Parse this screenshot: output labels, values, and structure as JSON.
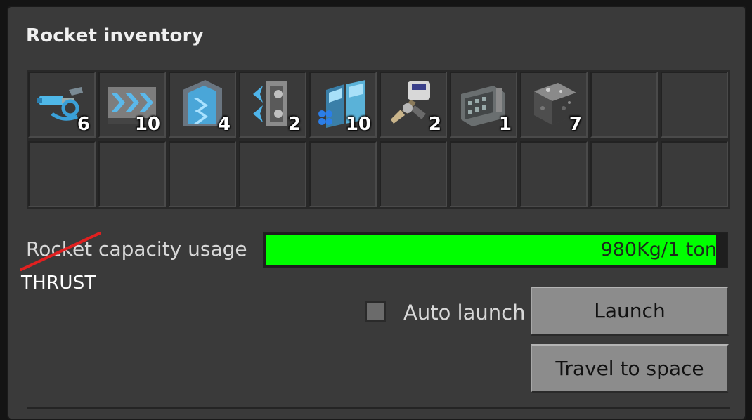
{
  "panel": {
    "title": "Rocket inventory"
  },
  "inventory": {
    "slots": [
      {
        "icon": "electric-pole-icon",
        "count": "6"
      },
      {
        "icon": "express-transport-belt-icon",
        "count": "10"
      },
      {
        "icon": "express-underground-belt-icon",
        "count": "4"
      },
      {
        "icon": "express-splitter-icon",
        "count": "2"
      },
      {
        "icon": "solar-panel-icon",
        "count": "10"
      },
      {
        "icon": "inserter-icon",
        "count": "2"
      },
      {
        "icon": "assembling-machine-icon",
        "count": "1"
      },
      {
        "icon": "concrete-icon",
        "count": "7"
      },
      {
        "icon": "",
        "count": ""
      },
      {
        "icon": "",
        "count": ""
      },
      {
        "icon": "",
        "count": ""
      },
      {
        "icon": "",
        "count": ""
      },
      {
        "icon": "",
        "count": ""
      },
      {
        "icon": "",
        "count": ""
      },
      {
        "icon": "",
        "count": ""
      },
      {
        "icon": "",
        "count": ""
      },
      {
        "icon": "",
        "count": ""
      },
      {
        "icon": "",
        "count": ""
      },
      {
        "icon": "",
        "count": ""
      },
      {
        "icon": "",
        "count": ""
      }
    ]
  },
  "capacity": {
    "label": "Rocket capacity usage",
    "annotation": "THRUST",
    "value_text": "980Kg/1 ton",
    "fill_fraction": 0.98,
    "fill_color": "#00ff00"
  },
  "controls": {
    "auto_launch_label": "Auto launch",
    "auto_launch_checked": false,
    "launch_label": "Launch",
    "travel_label": "Travel to space"
  }
}
